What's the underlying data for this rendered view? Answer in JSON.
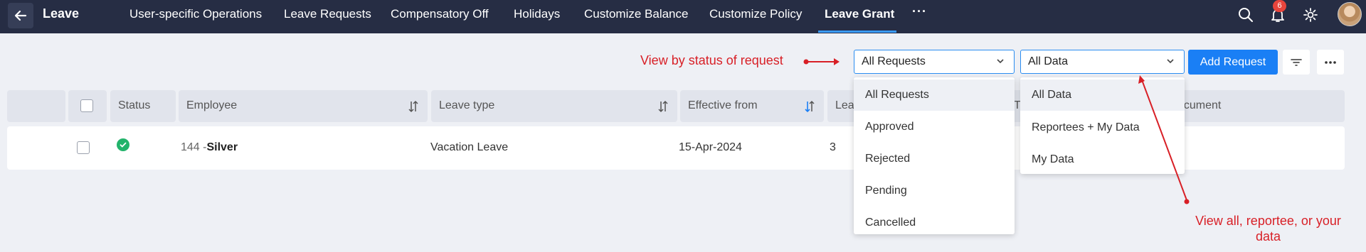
{
  "app": {
    "title": "Leave"
  },
  "nav": {
    "tabs": [
      {
        "label": "User-specific Operations"
      },
      {
        "label": "Leave Requests"
      },
      {
        "label": "Compensatory Off"
      },
      {
        "label": "Holidays"
      },
      {
        "label": "Customize Balance"
      },
      {
        "label": "Customize Policy"
      },
      {
        "label": "Leave Grant"
      }
    ],
    "active_tab": "Leave Grant",
    "more": "···"
  },
  "header_icons": {
    "search": "search-icon",
    "bell": "bell-icon",
    "settings": "gear-icon",
    "notification_count": "6"
  },
  "toolbar": {
    "status_select": {
      "value": "All Requests"
    },
    "data_select": {
      "value": "All Data"
    },
    "add_label": "Add Request"
  },
  "annotations": {
    "status_hint": "View by status of request",
    "data_hint_line1": "View all, reportee, or your",
    "data_hint_line2": "data",
    "color": "#d81f26"
  },
  "table": {
    "columns": [
      "Status",
      "Employee",
      "Leave type",
      "Effective from",
      "Leav",
      "T",
      "ocument"
    ],
    "rows": [
      {
        "employee_id": "144 -",
        "employee_name": "Silver",
        "leave_type": "Vacation Leave",
        "effective_from": "15-Apr-2024",
        "leave_count": "3",
        "status": "approved"
      }
    ]
  },
  "status_dropdown": {
    "options": [
      "All Requests",
      "Approved",
      "Rejected",
      "Pending",
      "Cancelled"
    ],
    "selected": "All Requests"
  },
  "data_dropdown": {
    "options": [
      "All Data",
      "Reportees + My Data",
      "My Data"
    ],
    "selected": "All Data"
  },
  "colors": {
    "nav_bg": "#262d44",
    "accent": "#1a7ff5",
    "success": "#22b36b",
    "badge": "#e8453c"
  }
}
